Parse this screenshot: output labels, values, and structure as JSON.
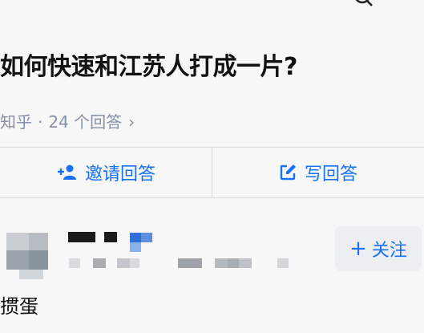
{
  "question": {
    "title": "如何快速和江苏人打成一片?",
    "source": "知乎",
    "separator": "·",
    "answer_count": "24 个回答",
    "chevron": "›"
  },
  "actions": {
    "invite_label": "邀请回答",
    "write_label": "写回答"
  },
  "answer": {
    "follow_label": "关注",
    "follow_plus": "+",
    "excerpt": "掼蛋"
  },
  "icons": {
    "back": "back-chevron-icon",
    "search": "search-icon",
    "invite": "add-person-icon",
    "write": "edit-icon"
  },
  "colors": {
    "accent": "#1772f6",
    "meta_text": "#8590a6",
    "background": "#f7f7f8"
  }
}
